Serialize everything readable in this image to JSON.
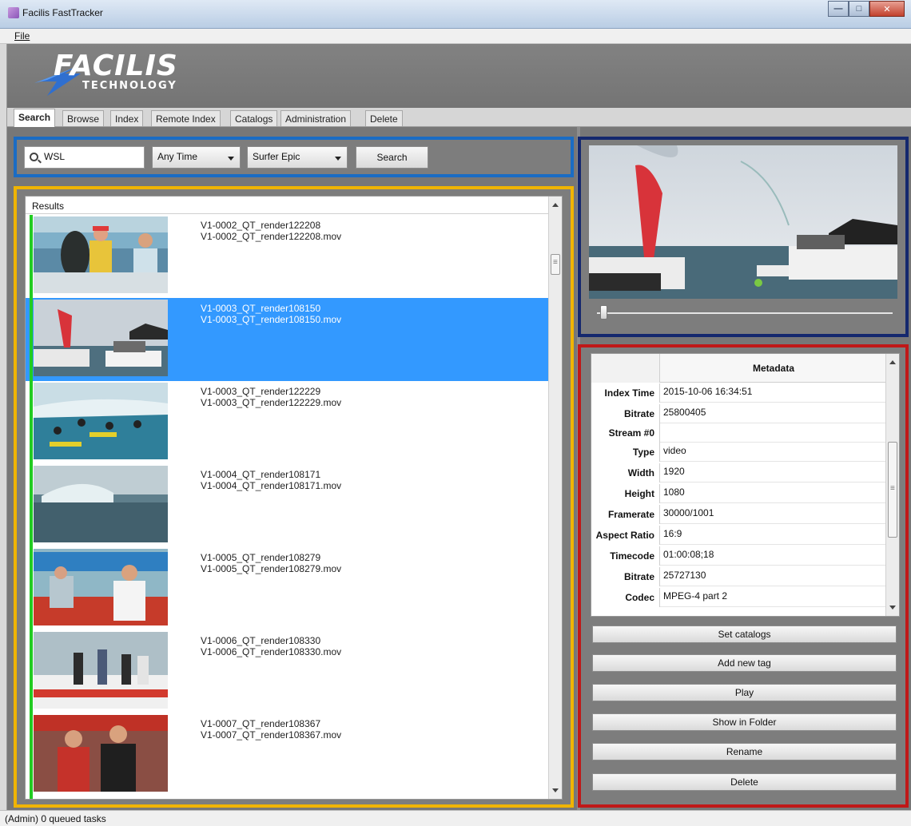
{
  "window": {
    "title": "Facilis FastTracker"
  },
  "menu": {
    "file": "File"
  },
  "logo": {
    "word": "FACILIS",
    "sub": "TECHNOLOGY"
  },
  "tabs": [
    "Search",
    "Browse",
    "Index",
    "Remote Index",
    "Catalogs",
    "Administration",
    "Delete"
  ],
  "search": {
    "query": "WSL",
    "time_filter": "Any Time",
    "catalog_filter": "Surfer Epic",
    "button": "Search"
  },
  "results": {
    "header": "Results",
    "items": [
      {
        "name": "V1-0002_QT_render122208",
        "file": "V1-0002_QT_render122208.mov"
      },
      {
        "name": "V1-0003_QT_render108150",
        "file": "V1-0003_QT_render108150.mov",
        "selected": true
      },
      {
        "name": "V1-0003_QT_render122229",
        "file": "V1-0003_QT_render122229.mov"
      },
      {
        "name": "V1-0004_QT_render108171",
        "file": "V1-0004_QT_render108171.mov"
      },
      {
        "name": "V1-0005_QT_render108279",
        "file": "V1-0005_QT_render108279.mov"
      },
      {
        "name": "V1-0006_QT_render108330",
        "file": "V1-0006_QT_render108330.mov"
      },
      {
        "name": "V1-0007_QT_render108367",
        "file": "V1-0007_QT_render108367.mov"
      }
    ]
  },
  "metadata": {
    "header": "Metadata",
    "rows": [
      {
        "key": "Index Time",
        "value": "2015-10-06 16:34:51"
      },
      {
        "key": "Bitrate",
        "value": "25800405"
      },
      {
        "key": "Stream #0",
        "value": ""
      },
      {
        "key": "Type",
        "value": "video"
      },
      {
        "key": "Width",
        "value": "1920"
      },
      {
        "key": "Height",
        "value": "1080"
      },
      {
        "key": "Framerate",
        "value": "30000/1001"
      },
      {
        "key": "Aspect Ratio",
        "value": "16:9"
      },
      {
        "key": "Timecode",
        "value": "01:00:08;18"
      },
      {
        "key": "Bitrate",
        "value": "25727130"
      },
      {
        "key": "Codec",
        "value": "MPEG-4 part 2"
      }
    ]
  },
  "actions": [
    "Set catalogs",
    "Add new tag",
    "Play",
    "Show in Folder",
    "Rename",
    "Delete"
  ],
  "status": {
    "text": "(Admin) 0 queued tasks"
  },
  "colors": {
    "search_border": "#1a6cc4",
    "results_border": "#f0b400",
    "preview_border": "#14286e",
    "metadata_border": "#c01818",
    "selection": "#3399ff",
    "indicator": "#22cc22"
  },
  "icons": [
    "app-icon",
    "search-icon",
    "dropdown-arrow-icon",
    "minimize-icon",
    "maximize-icon",
    "close-icon"
  ]
}
